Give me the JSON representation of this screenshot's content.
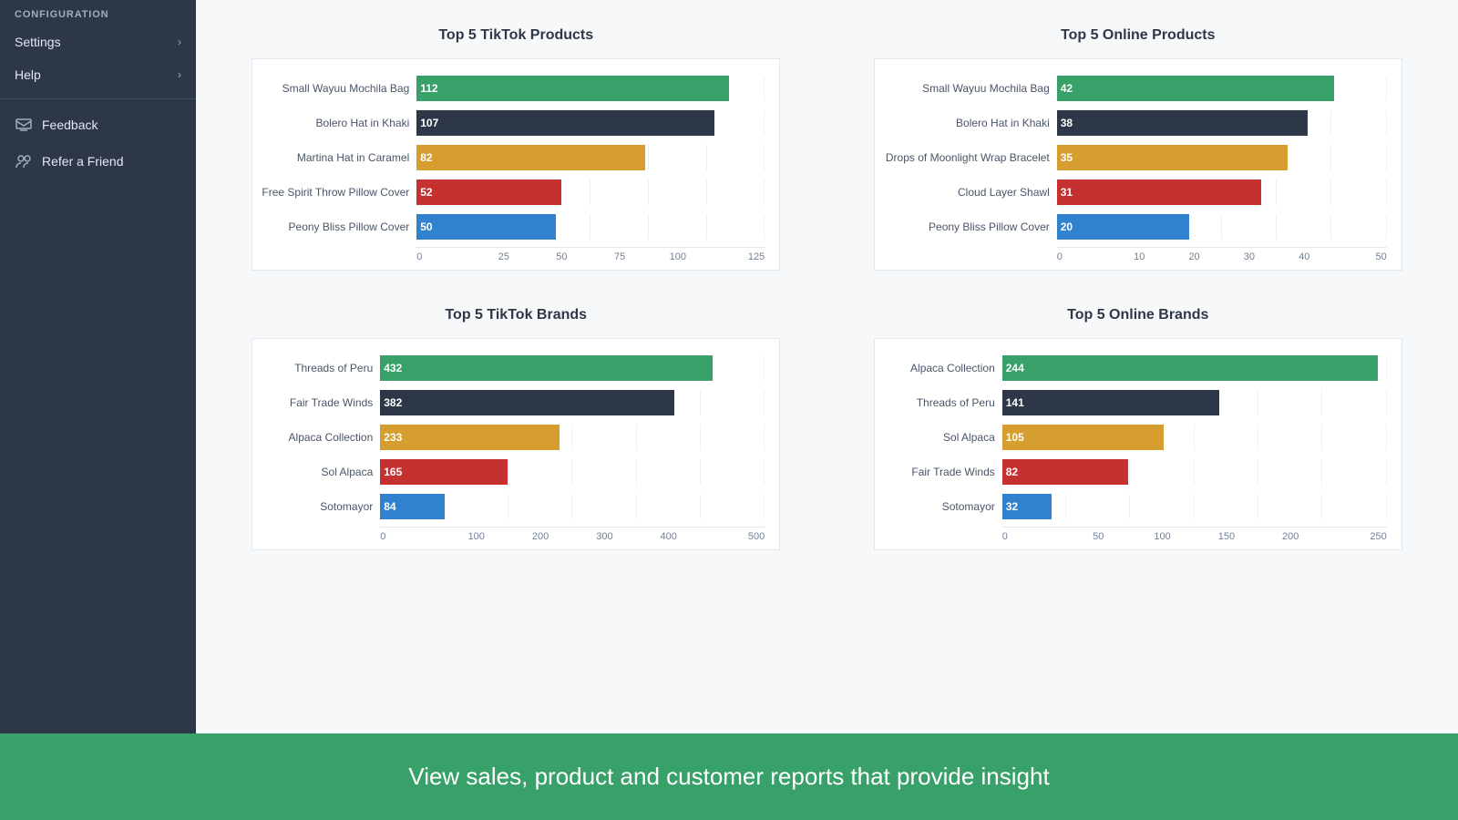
{
  "sidebar": {
    "section_label": "CONFIGURATION",
    "items": [
      {
        "label": "Settings",
        "has_chevron": true
      },
      {
        "label": "Help",
        "has_chevron": true
      }
    ],
    "footer_items": [
      {
        "label": "Feedback",
        "icon": "feedback-icon"
      },
      {
        "label": "Refer a Friend",
        "icon": "refer-icon"
      }
    ]
  },
  "charts": {
    "top_left": {
      "title": "Top 5 TikTok Products",
      "label_width": 180,
      "max_value": 125,
      "x_ticks": [
        "0",
        "25",
        "50",
        "75",
        "100",
        "125"
      ],
      "bars": [
        {
          "label": "Small Wayuu Mochila Bag",
          "value": 112,
          "color": "#38a169"
        },
        {
          "label": "Bolero Hat in Khaki",
          "value": 107,
          "color": "#2d3748"
        },
        {
          "label": "Martina Hat in Caramel",
          "value": 82,
          "color": "#d69e2e"
        },
        {
          "label": "Free Spirit Throw Pillow Cover",
          "value": 52,
          "color": "#c53030"
        },
        {
          "label": "Peony Bliss Pillow Cover",
          "value": 50,
          "color": "#3182ce"
        }
      ]
    },
    "top_right": {
      "title": "Top 5 Online Products",
      "label_width": 200,
      "max_value": 50,
      "x_ticks": [
        "0",
        "10",
        "20",
        "30",
        "40",
        "50"
      ],
      "bars": [
        {
          "label": "Small Wayuu Mochila Bag",
          "value": 42,
          "color": "#38a169"
        },
        {
          "label": "Bolero Hat in Khaki",
          "value": 38,
          "color": "#2d3748"
        },
        {
          "label": "Drops of Moonlight Wrap Bracelet",
          "value": 35,
          "color": "#d69e2e"
        },
        {
          "label": "Cloud Layer Shawl",
          "value": 31,
          "color": "#c53030"
        },
        {
          "label": "Peony Bliss Pillow Cover",
          "value": 20,
          "color": "#3182ce"
        }
      ]
    },
    "bottom_left": {
      "title": "Top 5 TikTok Brands",
      "label_width": 140,
      "max_value": 500,
      "x_ticks": [
        "0",
        "100",
        "200",
        "300",
        "400",
        "500"
      ],
      "bars": [
        {
          "label": "Threads of Peru",
          "value": 432,
          "color": "#38a169"
        },
        {
          "label": "Fair Trade Winds",
          "value": 382,
          "color": "#2d3748"
        },
        {
          "label": "Alpaca Collection",
          "value": 233,
          "color": "#d69e2e"
        },
        {
          "label": "Sol Alpaca",
          "value": 165,
          "color": "#c53030"
        },
        {
          "label": "Sotomayor",
          "value": 84,
          "color": "#3182ce"
        }
      ]
    },
    "bottom_right": {
      "title": "Top 5 Online Brands",
      "label_width": 140,
      "max_value": 250,
      "x_ticks": [
        "0",
        "50",
        "100",
        "150",
        "200",
        "250"
      ],
      "bars": [
        {
          "label": "Alpaca Collection",
          "value": 244,
          "color": "#38a169"
        },
        {
          "label": "Threads of Peru",
          "value": 141,
          "color": "#2d3748"
        },
        {
          "label": "Sol Alpaca",
          "value": 105,
          "color": "#d69e2e"
        },
        {
          "label": "Fair Trade Winds",
          "value": 82,
          "color": "#c53030"
        },
        {
          "label": "Sotomayor",
          "value": 32,
          "color": "#3182ce"
        }
      ]
    }
  },
  "footer": {
    "text": "View sales, product and customer reports that provide insight"
  },
  "colors": {
    "sidebar_bg": "#2d3748",
    "footer_bg": "#38a169"
  }
}
